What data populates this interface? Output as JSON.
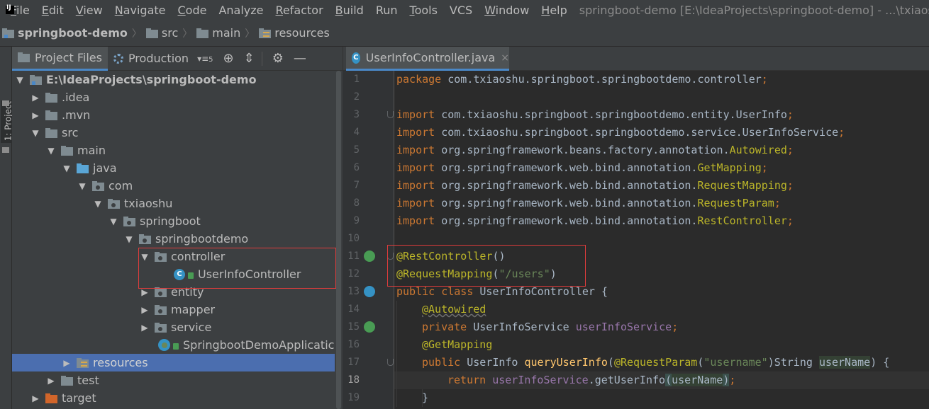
{
  "menubar": {
    "items": [
      {
        "label": "File",
        "mnemonic": "F",
        "rest": "ile"
      },
      {
        "label": "Edit",
        "mnemonic": "E",
        "rest": "dit"
      },
      {
        "label": "View",
        "mnemonic": "V",
        "rest": "iew"
      },
      {
        "label": "Navigate",
        "mnemonic": "N",
        "rest": "avigate"
      },
      {
        "label": "Code",
        "mnemonic": "C",
        "rest": "ode"
      },
      {
        "label": "Analyze",
        "mnemonic": "",
        "rest": "Analyze"
      },
      {
        "label": "Refactor",
        "mnemonic": "R",
        "rest": "efactor"
      },
      {
        "label": "Build",
        "mnemonic": "B",
        "rest": "uild"
      },
      {
        "label": "Run",
        "mnemonic": "",
        "rest": "Run"
      },
      {
        "label": "Tools",
        "mnemonic": "T",
        "rest": "ools"
      },
      {
        "label": "VCS",
        "mnemonic": "",
        "rest": "VCS"
      },
      {
        "label": "Window",
        "mnemonic": "W",
        "rest": "indow"
      },
      {
        "label": "Help",
        "mnemonic": "H",
        "rest": "elp"
      }
    ],
    "window_title": "springboot-demo [E:\\IdeaProjects\\springboot-demo] - ...\\txiaoshu\\spring"
  },
  "breadcrumb": {
    "project": "springboot-demo",
    "items": [
      "src",
      "main",
      "resources"
    ]
  },
  "sidestrip": {
    "tab_label": "1: Project"
  },
  "project_panel": {
    "tabs": [
      {
        "label": "Project Files",
        "active": true
      },
      {
        "label": "Production",
        "active": false
      }
    ],
    "view_count": "5",
    "tree": [
      {
        "label": "E:\\IdeaProjects\\springboot-demo",
        "arrow": "▼",
        "icon": "module-folder",
        "bold": true
      },
      {
        "label": ".idea",
        "arrow": "▶",
        "icon": "folder"
      },
      {
        "label": ".mvn",
        "arrow": "▶",
        "icon": "folder"
      },
      {
        "label": "src",
        "arrow": "▼",
        "icon": "folder"
      },
      {
        "label": "main",
        "arrow": "▼",
        "icon": "folder"
      },
      {
        "label": "java",
        "arrow": "▼",
        "icon": "source-folder"
      },
      {
        "label": "com",
        "arrow": "▼",
        "icon": "package"
      },
      {
        "label": "txiaoshu",
        "arrow": "▼",
        "icon": "package"
      },
      {
        "label": "springboot",
        "arrow": "▼",
        "icon": "package"
      },
      {
        "label": "springbootdemo",
        "arrow": "▼",
        "icon": "package"
      },
      {
        "label": "controller",
        "arrow": "▼",
        "icon": "package"
      },
      {
        "label": "UserInfoController",
        "arrow": "",
        "icon": "class"
      },
      {
        "label": "entity",
        "arrow": "▶",
        "icon": "package"
      },
      {
        "label": "mapper",
        "arrow": "▶",
        "icon": "package"
      },
      {
        "label": "service",
        "arrow": "▶",
        "icon": "package"
      },
      {
        "label": "SpringbootDemoApplicatic",
        "arrow": "",
        "icon": "spring-boot-class"
      },
      {
        "label": "resources",
        "arrow": "▶",
        "icon": "resources-folder",
        "selected": true
      },
      {
        "label": "test",
        "arrow": "▶",
        "icon": "folder"
      },
      {
        "label": "target",
        "arrow": "▶",
        "icon": "excluded-folder"
      }
    ]
  },
  "editor": {
    "tab_label": "UserInfoController.java",
    "current_line": 18,
    "lines": [
      {
        "n": "1"
      },
      {
        "n": "2"
      },
      {
        "n": "3"
      },
      {
        "n": "4"
      },
      {
        "n": "5"
      },
      {
        "n": "6"
      },
      {
        "n": "7"
      },
      {
        "n": "8"
      },
      {
        "n": "9"
      },
      {
        "n": "10"
      },
      {
        "n": "11"
      },
      {
        "n": "12"
      },
      {
        "n": "13"
      },
      {
        "n": "14"
      },
      {
        "n": "15"
      },
      {
        "n": "16"
      },
      {
        "n": "17"
      },
      {
        "n": "18"
      },
      {
        "n": "19"
      }
    ],
    "code": {
      "l1": {
        "kw": "package",
        "rest": " com.txiaoshu.springboot.springbootdemo.controller",
        "semi": ";"
      },
      "l3": {
        "kw": "import",
        "rest": " com.txiaoshu.springboot.springbootdemo.entity.UserInfo",
        "semi": ";"
      },
      "l4": {
        "kw": "import",
        "rest": " com.txiaoshu.springboot.springbootdemo.service.UserInfoService",
        "semi": ";"
      },
      "l5": {
        "kw": "import",
        "rest": " org.springframework.beans.factory.annotation.",
        "ann": "Autowired",
        "semi": ";"
      },
      "l6": {
        "kw": "import",
        "rest": " org.springframework.web.bind.annotation.",
        "ann": "GetMapping",
        "semi": ";"
      },
      "l7": {
        "kw": "import",
        "rest": " org.springframework.web.bind.annotation.",
        "ann": "RequestMapping",
        "semi": ";"
      },
      "l8": {
        "kw": "import",
        "rest": " org.springframework.web.bind.annotation.",
        "ann": "RequestParam",
        "semi": ";"
      },
      "l9": {
        "kw": "import",
        "rest": " org.springframework.web.bind.annotation.",
        "ann": "RestController",
        "semi": ";"
      },
      "l11": {
        "ann": "@RestController",
        "rest": "()"
      },
      "l12": {
        "ann": "@RequestMapping",
        "open": "(",
        "str": "\"/users\"",
        "close": ")"
      },
      "l13": {
        "kw": "public class",
        "rest": " UserInfoController {"
      },
      "l14": {
        "ann": "@Autowired"
      },
      "l15": {
        "kw": "private",
        "type": " UserInfoService ",
        "field": "userInfoService",
        "semi": ";"
      },
      "l16": {
        "ann": "@GetMapping"
      },
      "l17": {
        "kw": "public",
        "type": " UserInfo ",
        "fn": "queryUserInfo",
        "p1": "(",
        "ann": "@RequestParam",
        "p2": "(",
        "str": "\"username\"",
        "p3": ")String ",
        "param": "userName",
        "p4": ") {"
      },
      "l18": {
        "kw": "return",
        "sp": " ",
        "field": "userInfoService",
        "call": ".getUserInfo",
        "p1": "(",
        "param": "userName",
        "p2": ")",
        "semi": ";"
      },
      "l19": {
        "rest": "}"
      }
    }
  },
  "colors": {
    "keyword": "#cc7832",
    "annotation": "#bbb529",
    "string": "#6a8759",
    "field": "#9876aa",
    "method": "#ffc66d",
    "highlight_box": "#e03c3c",
    "selection": "#4b6eaf"
  }
}
